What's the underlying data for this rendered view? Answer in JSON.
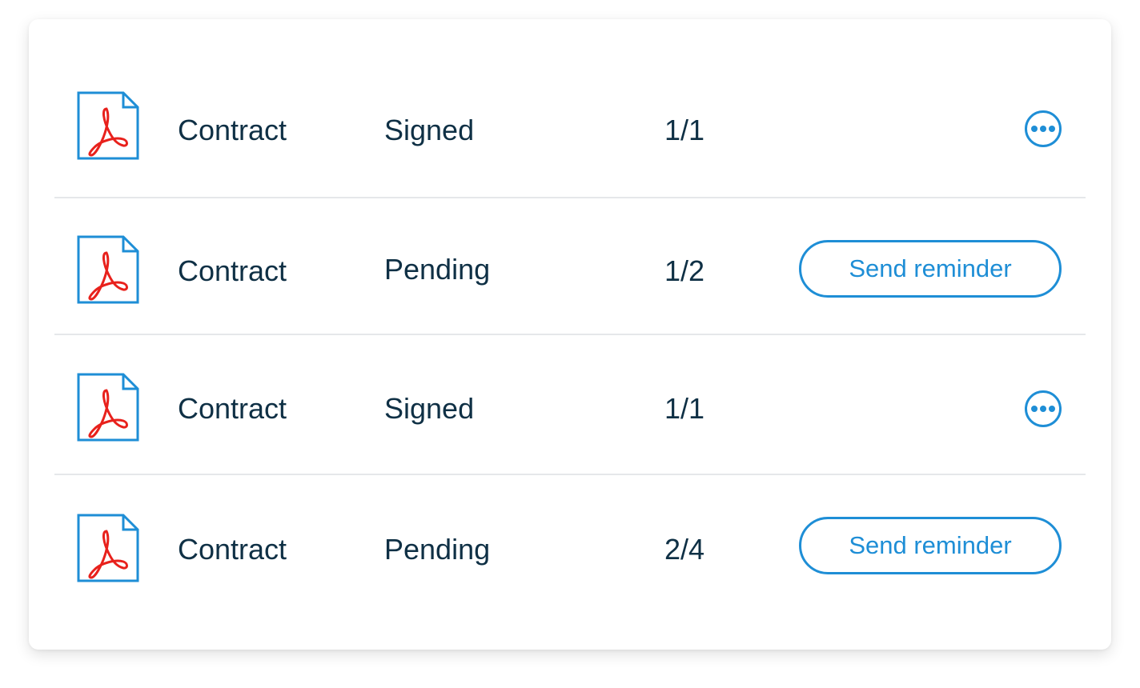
{
  "colors": {
    "accent": "#1e8ed6",
    "text": "#0f3045",
    "pdf_red": "#e8211c",
    "divider": "#e5e7ea"
  },
  "documents": [
    {
      "icon": "pdf-file-icon",
      "name": "Contract",
      "status": "Signed",
      "count": "1/1",
      "action": "more-options-icon"
    },
    {
      "icon": "pdf-file-icon",
      "name": "Contract",
      "status": "Pending",
      "count": "1/2",
      "action": "Send reminder"
    },
    {
      "icon": "pdf-file-icon",
      "name": "Contract",
      "status": "Signed",
      "count": "1/1",
      "action": "more-options-icon"
    },
    {
      "icon": "pdf-file-icon",
      "name": "Contract",
      "status": "Pending",
      "count": "2/4",
      "action": "Send reminder"
    }
  ]
}
